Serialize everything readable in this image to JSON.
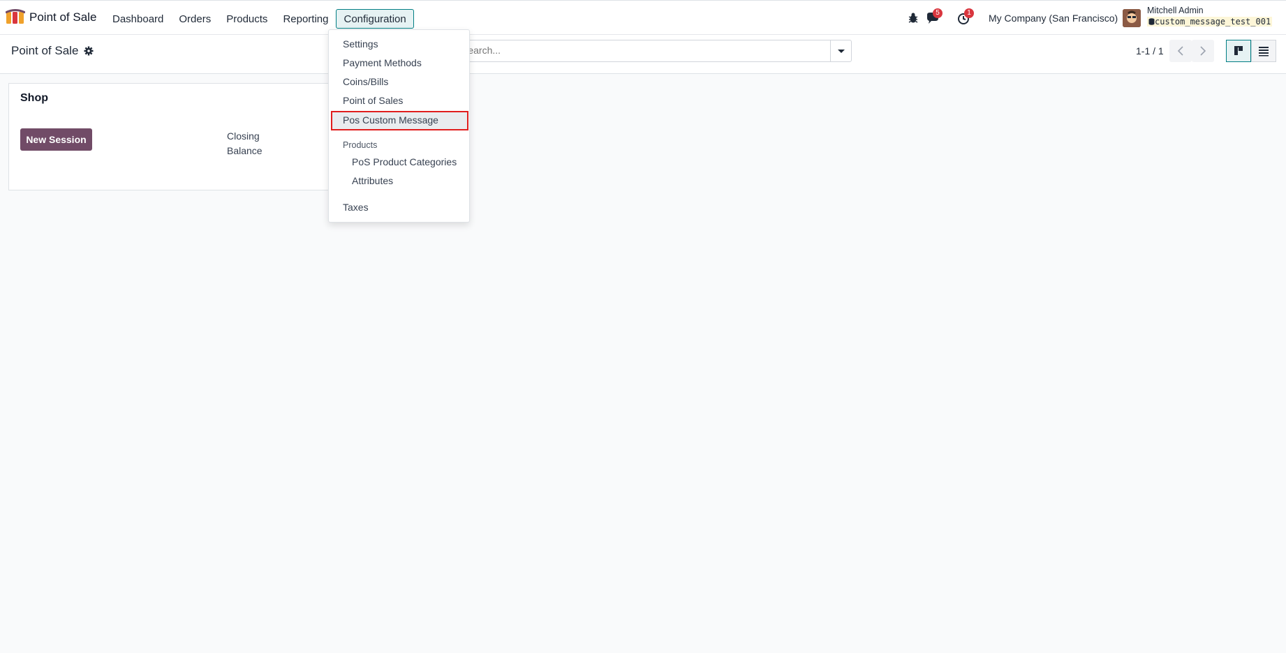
{
  "navbar": {
    "app_name": "Point of Sale",
    "menu": [
      "Dashboard",
      "Orders",
      "Products",
      "Reporting",
      "Configuration"
    ],
    "active_menu": "Configuration",
    "messages_count": "5",
    "activities_count": "1",
    "company": "My Company (San Francisco)",
    "user_name": "Mitchell Admin",
    "db_name": "custom_message_test_001"
  },
  "control_panel": {
    "breadcrumb": "Point of Sale",
    "search_placeholder": "Search...",
    "pager": "1-1 / 1"
  },
  "card": {
    "title": "Shop",
    "new_session_label": "New Session",
    "closing_balance_label": "Closing Balance"
  },
  "dropdown": {
    "items": [
      "Settings",
      "Payment Methods",
      "Coins/Bills",
      "Point of Sales",
      "Pos Custom Message"
    ],
    "section_label": "Products",
    "sub_items": [
      "PoS Product Categories",
      "Attributes"
    ],
    "last_item": "Taxes",
    "highlighted": "Pos Custom Message"
  },
  "colors": {
    "brand": "#714b67",
    "accent": "#017e84",
    "badge": "#d9363e",
    "highlight_border": "#e01e1e"
  }
}
